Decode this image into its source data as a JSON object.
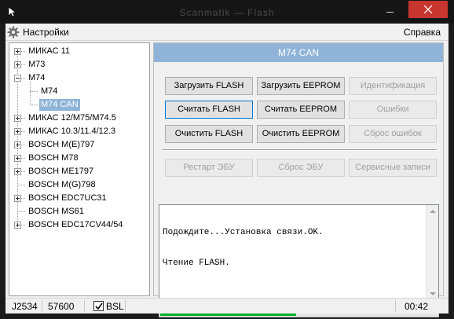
{
  "window": {
    "title": "Scanmatik — Flash",
    "minimize_icon": "minimize-icon",
    "close_icon": "close-icon",
    "close_color": "#c7372f"
  },
  "menu": {
    "settings_label": "Настройки",
    "settings_icon": "gear-icon",
    "help_label": "Справка"
  },
  "tree": {
    "items": [
      {
        "label": "МИКАС 11",
        "level": 0,
        "expander": "plus"
      },
      {
        "label": "M73",
        "level": 0,
        "expander": "plus"
      },
      {
        "label": "M74",
        "level": 0,
        "expander": "minus"
      },
      {
        "label": "M74",
        "level": 1,
        "expander": "none"
      },
      {
        "label": "M74 CAN",
        "level": 1,
        "expander": "none",
        "selected": true
      },
      {
        "label": "МИКАС 12/M75/M74.5",
        "level": 0,
        "expander": "plus"
      },
      {
        "label": "МИКАС 10.3/11.4/12.3",
        "level": 0,
        "expander": "plus"
      },
      {
        "label": "BOSCH M(E)797",
        "level": 0,
        "expander": "plus"
      },
      {
        "label": "BOSCH M78",
        "level": 0,
        "expander": "plus"
      },
      {
        "label": "BOSCH ME1797",
        "level": 0,
        "expander": "plus"
      },
      {
        "label": "BOSCH M(G)798",
        "level": 0,
        "expander": "none"
      },
      {
        "label": "BOSCH EDC7UC31",
        "level": 0,
        "expander": "plus"
      },
      {
        "label": "BOSCH MS61",
        "level": 0,
        "expander": "none"
      },
      {
        "label": "BOSCH EDC17CV44/54",
        "level": 0,
        "expander": "plus"
      }
    ]
  },
  "panel": {
    "header": "M74 CAN",
    "header_color": "#8fb4d8",
    "buttons": {
      "load_flash": "Загрузить FLASH",
      "load_eeprom": "Загрузить EEPROM",
      "identification": "Идентификация",
      "read_flash": "Считать FLASH",
      "read_eeprom": "Считать EEPROM",
      "errors": "Ошибки",
      "clear_flash": "Очистить FLASH",
      "clear_eeprom": "Очистить EEPROM",
      "reset_errors": "Сброс ошибок",
      "restart_ecu": "Рестарт ЭБУ",
      "reset_ecu": "Сброс ЭБУ",
      "service_records": "Сервисные записи"
    }
  },
  "log": {
    "lines": [
      "Подождите...Установка связи.OK.",
      "Чтение FLASH."
    ]
  },
  "progress": {
    "value_percent": 49,
    "color": "#06b025"
  },
  "status": {
    "adapter": "J2534",
    "baud": "57600",
    "bsl_checked": true,
    "bsl_label": "BSL",
    "time": "00:42"
  }
}
